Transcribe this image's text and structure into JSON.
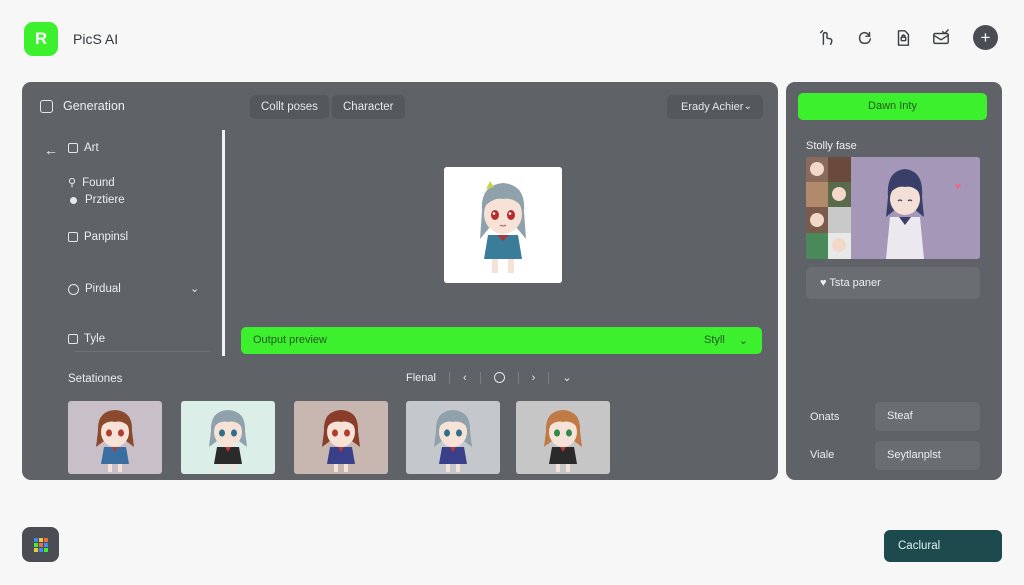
{
  "app": {
    "logo_letter": "R",
    "name": "PicS AI"
  },
  "top_icons": [
    "hand-pointer-icon",
    "refresh-icon",
    "document-lock-icon",
    "mail-check-icon"
  ],
  "top_plus": "+",
  "main": {
    "title": "Generation",
    "tabs": [
      "Collt poses",
      "Character"
    ],
    "select": {
      "value": "Erady Achier",
      "chevron": "⌄"
    },
    "sidebar": {
      "back": "←",
      "items": [
        "Art",
        "Found",
        "Prztiere",
        "Panpinsl",
        "Pirdual",
        "Tyle"
      ],
      "chevron": "⌄"
    },
    "output": {
      "label": "Output preview",
      "right_label": "Styll",
      "chevron": "⌄"
    },
    "selections": {
      "label": "Setationes",
      "filter_label": "Flenal",
      "prev": "‹",
      "next": "›",
      "chevron": "⌄"
    },
    "thumbnails": [
      {
        "bg": "#c9bfc9",
        "hair": "#8a4a2e",
        "eyes": "#b33a2e",
        "outfit": "#3a6ea0"
      },
      {
        "bg": "#dbeee7",
        "hair": "#8fa1ab",
        "eyes": "#2e6f8a",
        "outfit": "#2a2a2a"
      },
      {
        "bg": "#c8b7b0",
        "hair": "#8a3d2a",
        "eyes": "#b33a2e",
        "outfit": "#3a3f8a"
      },
      {
        "bg": "#c4c8cd",
        "hair": "#8fa1ab",
        "eyes": "#2e6f8a",
        "outfit": "#3a3f8a"
      },
      {
        "bg": "#c6c6c6",
        "hair": "#c07a46",
        "eyes": "#2e8a4a",
        "outfit": "#2a2a2a"
      }
    ]
  },
  "right": {
    "download_label": "Dawn Inty",
    "style_label": "Stolly fase",
    "test_label": "Tsta paner",
    "fields": [
      {
        "label": "Onats",
        "value": "Steaf"
      },
      {
        "label": "Viale",
        "value": "Seytlanplst"
      }
    ]
  },
  "bottom": {
    "calc_label": "Caclural"
  },
  "colors": {
    "accent": "#3df02e",
    "panel": "#5f6368",
    "primary_dark": "#1d4a4c"
  }
}
